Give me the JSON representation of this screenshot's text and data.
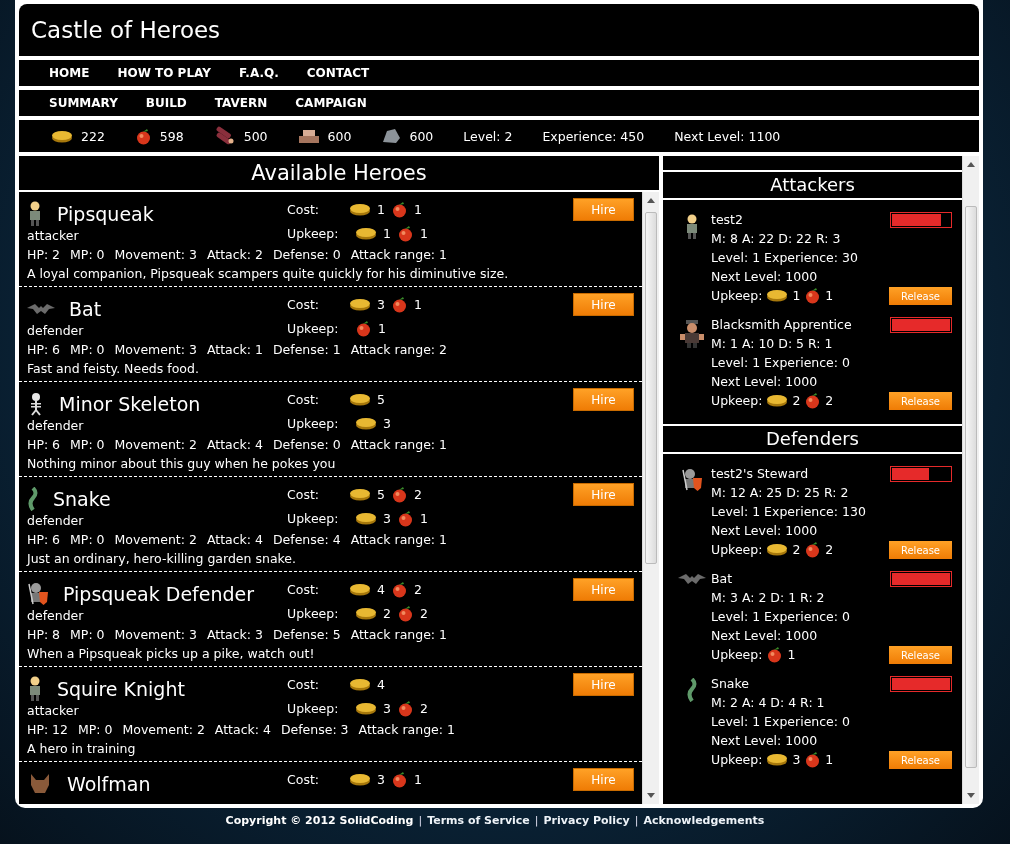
{
  "site": {
    "title": "Castle of Heroes"
  },
  "main_nav": [
    {
      "label": "HOME"
    },
    {
      "label": "HOW TO PLAY"
    },
    {
      "label": "F.A.Q."
    },
    {
      "label": "CONTACT"
    }
  ],
  "game_nav": [
    {
      "label": "SUMMARY"
    },
    {
      "label": "BUILD"
    },
    {
      "label": "TAVERN"
    },
    {
      "label": "CAMPAIGN"
    }
  ],
  "resources": [
    {
      "kind": "gold",
      "amount": "222"
    },
    {
      "kind": "food",
      "amount": "598"
    },
    {
      "kind": "wood",
      "amount": "500"
    },
    {
      "kind": "brick",
      "amount": "600"
    },
    {
      "kind": "stone",
      "amount": "600"
    }
  ],
  "player_stats": [
    "Level: 2",
    "Experience: 450",
    "Next Level: 1100"
  ],
  "available_heroes": {
    "title": "Available Heroes",
    "heroes": [
      {
        "kind": "person",
        "name": "Pipsqueak",
        "cost_label": "Cost:",
        "cost": [
          {
            "kind": "gold",
            "amount": "1"
          },
          {
            "kind": "food",
            "amount": "1"
          }
        ],
        "upkeep_label": "Upkeep:",
        "upkeep": [
          {
            "kind": "gold",
            "amount": "1"
          },
          {
            "kind": "food",
            "amount": "1"
          }
        ],
        "hire_label": "Hire",
        "role": "attacker",
        "stats": [
          "HP: 2",
          "MP: 0",
          "Movement: 3",
          "Attack: 2",
          "Defense: 0",
          "Attack range: 1"
        ],
        "description": "A loyal companion, Pipsqueak scampers quite quickly for his diminutive size."
      },
      {
        "kind": "bat",
        "name": "Bat",
        "cost_label": "Cost:",
        "cost": [
          {
            "kind": "gold",
            "amount": "3"
          },
          {
            "kind": "food",
            "amount": "1"
          }
        ],
        "upkeep_label": "Upkeep:",
        "upkeep": [
          {
            "kind": "food",
            "amount": "1"
          }
        ],
        "hire_label": "Hire",
        "role": "defender",
        "stats": [
          "HP: 6",
          "MP: 0",
          "Movement: 3",
          "Attack: 1",
          "Defense: 1",
          "Attack range: 2"
        ],
        "description": "Fast and feisty. Needs food."
      },
      {
        "kind": "skeleton",
        "name": "Minor Skeleton",
        "cost_label": "Cost:",
        "cost": [
          {
            "kind": "gold",
            "amount": "5"
          }
        ],
        "upkeep_label": "Upkeep:",
        "upkeep": [
          {
            "kind": "gold",
            "amount": "3"
          }
        ],
        "hire_label": "Hire",
        "role": "defender",
        "stats": [
          "HP: 6",
          "MP: 0",
          "Movement: 2",
          "Attack: 4",
          "Defense: 0",
          "Attack range: 1"
        ],
        "description": "Nothing minor about this guy when he pokes you"
      },
      {
        "kind": "snake",
        "name": "Snake",
        "cost_label": "Cost:",
        "cost": [
          {
            "kind": "gold",
            "amount": "5"
          },
          {
            "kind": "food",
            "amount": "2"
          }
        ],
        "upkeep_label": "Upkeep:",
        "upkeep": [
          {
            "kind": "gold",
            "amount": "3"
          },
          {
            "kind": "food",
            "amount": "1"
          }
        ],
        "hire_label": "Hire",
        "role": "defender",
        "stats": [
          "HP: 6",
          "MP: 0",
          "Movement: 2",
          "Attack: 4",
          "Defense: 4",
          "Attack range: 1"
        ],
        "description": "Just an ordinary, hero-killing garden snake."
      },
      {
        "kind": "shield",
        "name": "Pipsqueak Defender",
        "cost_label": "Cost:",
        "cost": [
          {
            "kind": "gold",
            "amount": "4"
          },
          {
            "kind": "food",
            "amount": "2"
          }
        ],
        "upkeep_label": "Upkeep:",
        "upkeep": [
          {
            "kind": "gold",
            "amount": "2"
          },
          {
            "kind": "food",
            "amount": "2"
          }
        ],
        "hire_label": "Hire",
        "role": "defender",
        "stats": [
          "HP: 8",
          "MP: 0",
          "Movement: 3",
          "Attack: 3",
          "Defense: 5",
          "Attack range: 1"
        ],
        "description": "When a Pipsqueak picks up a pike, watch out!"
      },
      {
        "kind": "person",
        "name": "Squire Knight",
        "cost_label": "Cost:",
        "cost": [
          {
            "kind": "gold",
            "amount": "4"
          }
        ],
        "upkeep_label": "Upkeep:",
        "upkeep": [
          {
            "kind": "gold",
            "amount": "3"
          },
          {
            "kind": "food",
            "amount": "2"
          }
        ],
        "hire_label": "Hire",
        "role": "attacker",
        "stats": [
          "HP: 12",
          "MP: 0",
          "Movement: 2",
          "Attack: 4",
          "Defense: 3",
          "Attack range: 1"
        ],
        "description": "A hero in training"
      },
      {
        "kind": "wolf",
        "name": "Wolfman",
        "cost_label": "Cost:",
        "cost": [
          {
            "kind": "gold",
            "amount": "3"
          },
          {
            "kind": "food",
            "amount": "1"
          }
        ],
        "hire_label": "Hire"
      }
    ]
  },
  "army": {
    "groups": [
      {
        "title": "Attackers",
        "heroes": [
          {
            "kind": "person",
            "name": "test2",
            "level": 0.85,
            "stats": "M: 8 A: 22 D: 22 R: 3",
            "experience": "Level: 1 Experience: 30",
            "next_level": "Next Level: 1000",
            "upkeep_label": "Upkeep:",
            "upkeep": [
              {
                "kind": "gold",
                "amount": "1"
              },
              {
                "kind": "food",
                "amount": "1"
              }
            ],
            "release_label": "Release"
          },
          {
            "kind": "brute",
            "name": "Blacksmith Apprentice",
            "level": 1,
            "stats": "M: 1 A: 10 D: 5 R: 1",
            "experience": "Level: 1 Experience: 0",
            "next_level": "Next Level: 1000",
            "upkeep_label": "Upkeep:",
            "upkeep": [
              {
                "kind": "gold",
                "amount": "2"
              },
              {
                "kind": "food",
                "amount": "2"
              }
            ],
            "release_label": "Release"
          }
        ]
      },
      {
        "title": "Defenders",
        "heroes": [
          {
            "kind": "shield",
            "name": "test2's Steward",
            "level": 0.64,
            "stats": "M: 12 A: 25 D: 25 R: 2",
            "experience": "Level: 1 Experience: 130",
            "next_level": "Next Level: 1000",
            "upkeep_label": "Upkeep:",
            "upkeep": [
              {
                "kind": "gold",
                "amount": "2"
              },
              {
                "kind": "food",
                "amount": "2"
              }
            ],
            "release_label": "Release"
          },
          {
            "kind": "bat",
            "name": "Bat",
            "level": 1,
            "stats": "M: 3 A: 2 D: 1 R: 2",
            "experience": "Level: 1 Experience: 0",
            "next_level": "Next Level: 1000",
            "upkeep_label": "Upkeep:",
            "upkeep": [
              {
                "kind": "food",
                "amount": "1"
              }
            ],
            "release_label": "Release"
          },
          {
            "kind": "snake",
            "name": "Snake",
            "level": 1,
            "stats": "M: 2 A: 4 D: 4 R: 1",
            "experience": "Level: 1 Experience: 0",
            "next_level": "Next Level: 1000",
            "upkeep_label": "Upkeep:",
            "upkeep": [
              {
                "kind": "gold",
                "amount": "3"
              },
              {
                "kind": "food",
                "amount": "1"
              }
            ],
            "release_label": "Release"
          }
        ]
      }
    ]
  },
  "footer": [
    {
      "kind": "text",
      "text": "Copyright © 2012 SolidCoding"
    },
    {
      "kind": "separator",
      "text": "|"
    },
    {
      "kind": "link",
      "text": "Terms of Service"
    },
    {
      "kind": "separator",
      "text": "|"
    },
    {
      "kind": "link",
      "text": "Privacy Policy"
    },
    {
      "kind": "separator",
      "text": "|"
    },
    {
      "kind": "link",
      "text": "Acknowledgements"
    }
  ]
}
